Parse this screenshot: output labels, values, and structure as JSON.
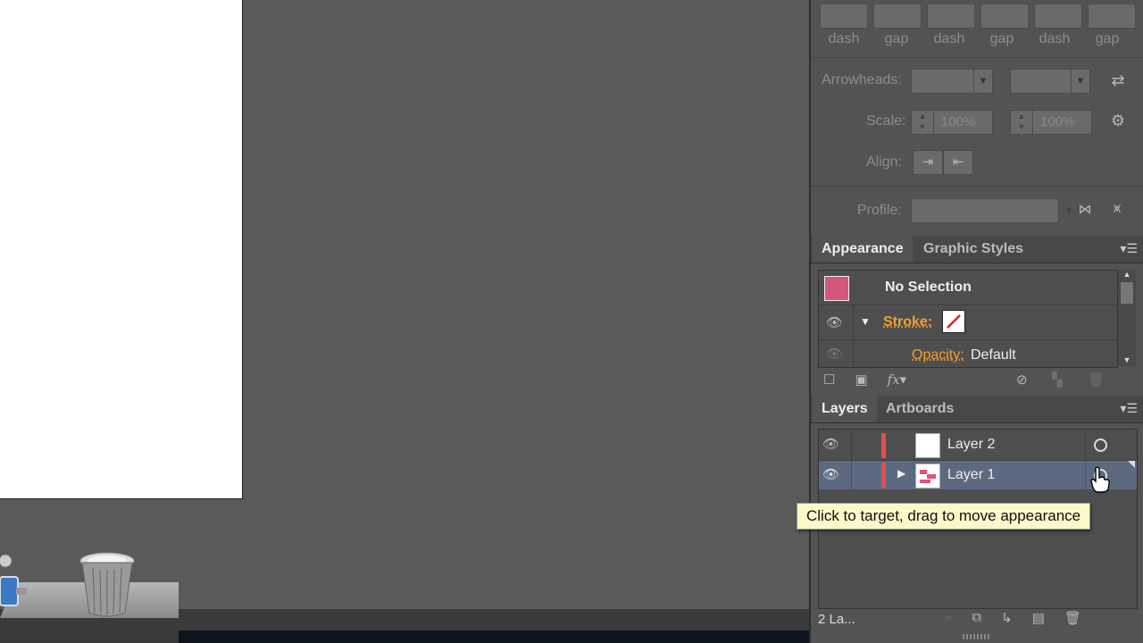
{
  "stroke_panel": {
    "dash_labels": [
      "dash",
      "gap",
      "dash",
      "gap",
      "dash",
      "gap"
    ],
    "arrowheads_label": "Arrowheads:",
    "scale_label": "Scale:",
    "scale_start": "100%",
    "scale_end": "100%",
    "align_label": "Align:",
    "profile_label": "Profile:"
  },
  "appearance_panel": {
    "tabs": [
      "Appearance",
      "Graphic Styles"
    ],
    "title": "No Selection",
    "stroke_label": "Stroke:",
    "opacity_label": "Opacity:",
    "opacity_value": "Default",
    "swatch_color": "#d4567a"
  },
  "layers_panel": {
    "tabs": [
      "Layers",
      "Artboards"
    ],
    "layers": [
      {
        "name": "Layer 2",
        "color": "#e05050"
      },
      {
        "name": "Layer 1",
        "color": "#e05050"
      }
    ],
    "tooltip": "Click to target, drag to move appearance",
    "footer_count": "2 La..."
  },
  "colors": {
    "accent_orange": "#f0a030",
    "selected_row": "#5b6a80"
  }
}
